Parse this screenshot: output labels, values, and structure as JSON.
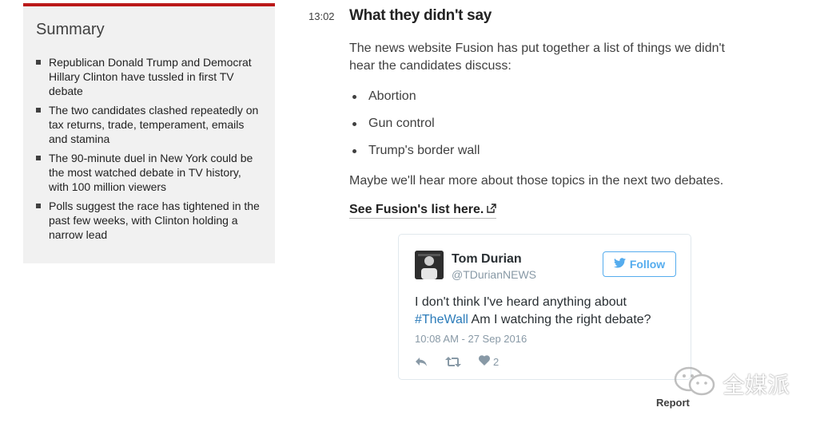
{
  "summary": {
    "title": "Summary",
    "items": [
      "Republican Donald Trump and Democrat Hillary Clinton have tussled in first TV debate",
      "The two candidates clashed repeatedly on tax returns, trade, temperament, emails and stamina",
      "The 90-minute duel in New York could be the most watched debate in TV history, with 100 million viewers",
      "Polls suggest the race has tightened in the past few weeks, with Clinton holding a narrow lead"
    ]
  },
  "entry": {
    "time": "13:02",
    "headline": "What they didn't say",
    "intro": "The news website Fusion has put together a list of things we didn't hear the candidates discuss:",
    "topics": [
      "Abortion",
      "Gun control",
      "Trump's border wall"
    ],
    "outro": "Maybe we'll hear more about those topics in the next two debates.",
    "link_text": "See Fusion's list here."
  },
  "tweet": {
    "name": "Tom Durian",
    "handle": "@TDurianNEWS",
    "follow_label": "Follow",
    "text_before": "I don't think I've heard anything about ",
    "hashtag": "#TheWall",
    "text_after": " Am I watching the right debate?",
    "date": "10:08 AM - 27 Sep 2016",
    "likes": "2",
    "icons": [
      "reply-icon",
      "retweet-icon",
      "heart-icon",
      "twitter-bird-icon"
    ]
  },
  "report_label": "Report",
  "watermark": {
    "text": "全媒派",
    "icon": "wechat-icon"
  },
  "colors": {
    "summary_border": "#bb1919",
    "summary_bg": "#f1f1f1",
    "twitter_blue": "#55acee",
    "hashtag": "#2b7bb9",
    "muted": "#8899a6"
  }
}
